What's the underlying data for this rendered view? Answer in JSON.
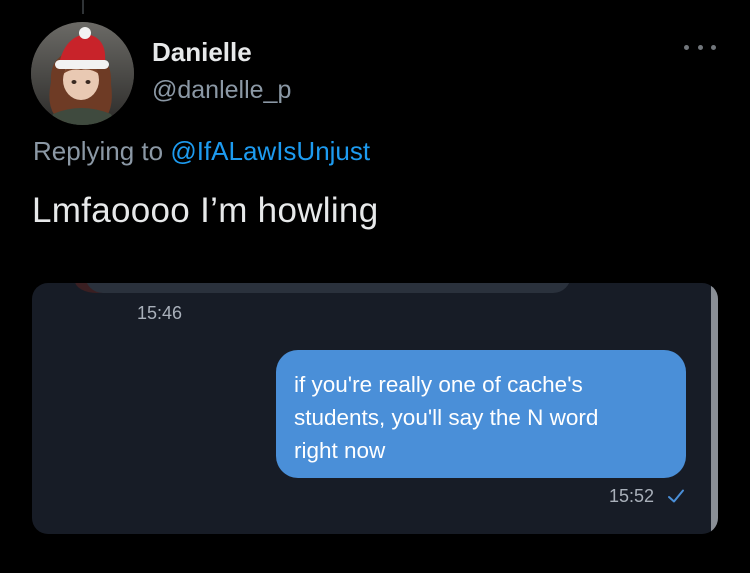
{
  "tweet": {
    "display_name": "Danielle",
    "handle": "@danlelle_p",
    "replying_prefix": "Replying to",
    "replying_to": "@IfALawIsUnjust",
    "text": "Lmfaoooo I’m howling",
    "more_icon": "more-horizontal-icon"
  },
  "media": {
    "time_received": "15:46",
    "message": "if you're really one of cache's\nstudents, you'll say the N word\nright now",
    "time_sent": "15:52",
    "read_icon": "check-icon",
    "colors": {
      "bubble": "#4a8fd8",
      "background": "#171c26"
    }
  },
  "colors": {
    "accent": "#1d9bf0",
    "background": "#000000",
    "secondary_text": "#8b98a5"
  }
}
